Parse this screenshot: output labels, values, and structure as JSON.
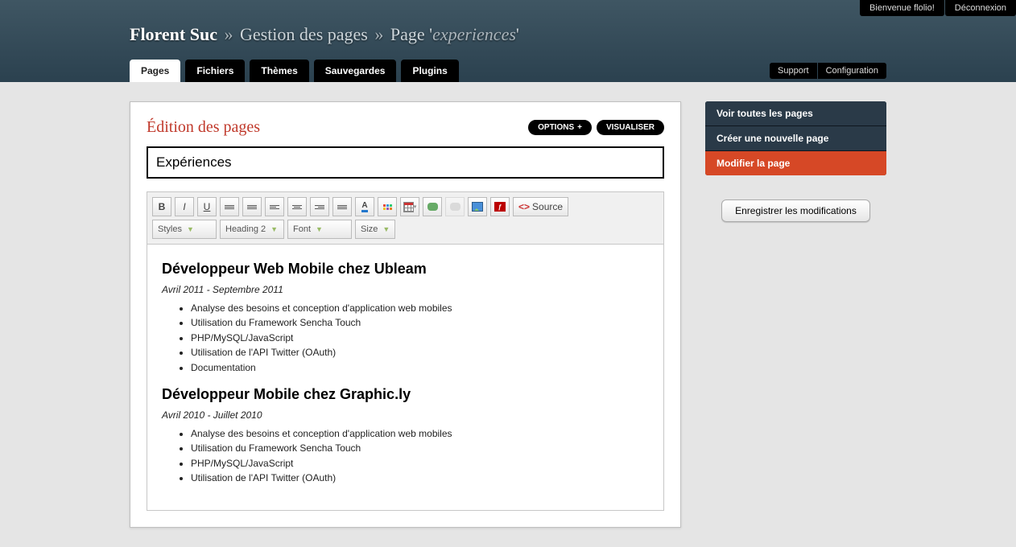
{
  "topbar": {
    "welcome": "Bienvenue flolio!",
    "logout": "Déconnexion"
  },
  "breadcrumb": {
    "site": "Florent Suc",
    "sep": "»",
    "section": "Gestion des pages",
    "page_label": "Page",
    "page_name": "experiences"
  },
  "nav": {
    "tabs": [
      {
        "label": "Pages",
        "active": true
      },
      {
        "label": "Fichiers"
      },
      {
        "label": "Thèmes"
      },
      {
        "label": "Sauvegardes"
      },
      {
        "label": "Plugins"
      }
    ],
    "right": {
      "support": "Support",
      "config": "Configuration"
    }
  },
  "panel": {
    "title": "Édition des pages",
    "options": "OPTIONS",
    "visualize": "VISUALISER",
    "page_title_value": "Expériences"
  },
  "toolbar": {
    "source": "Source",
    "selects": {
      "styles": "Styles",
      "format": "Heading 2",
      "font": "Font",
      "size": "Size"
    }
  },
  "content": {
    "jobs": [
      {
        "title": "Développeur Web Mobile chez Ubleam",
        "dates": "Avril 2011 - Septembre 2011",
        "bullets": [
          "Analyse des besoins et conception d'application web mobiles",
          "Utilisation du Framework Sencha Touch",
          "PHP/MySQL/JavaScript",
          "Utilisation de l'API Twitter (OAuth)",
          "Documentation"
        ]
      },
      {
        "title": "Développeur Mobile chez Graphic.ly",
        "dates": "Avril 2010 - Juillet 2010",
        "bullets": [
          "Analyse des besoins et conception d'application web mobiles",
          "Utilisation du Framework Sencha Touch",
          "PHP/MySQL/JavaScript",
          "Utilisation de l'API Twitter (OAuth)"
        ]
      }
    ]
  },
  "sidebar": {
    "items": [
      {
        "label": "Voir toutes les pages"
      },
      {
        "label": "Créer une nouvelle page"
      },
      {
        "label": "Modifier la page",
        "active": true
      }
    ],
    "save": "Enregistrer les modifications"
  }
}
